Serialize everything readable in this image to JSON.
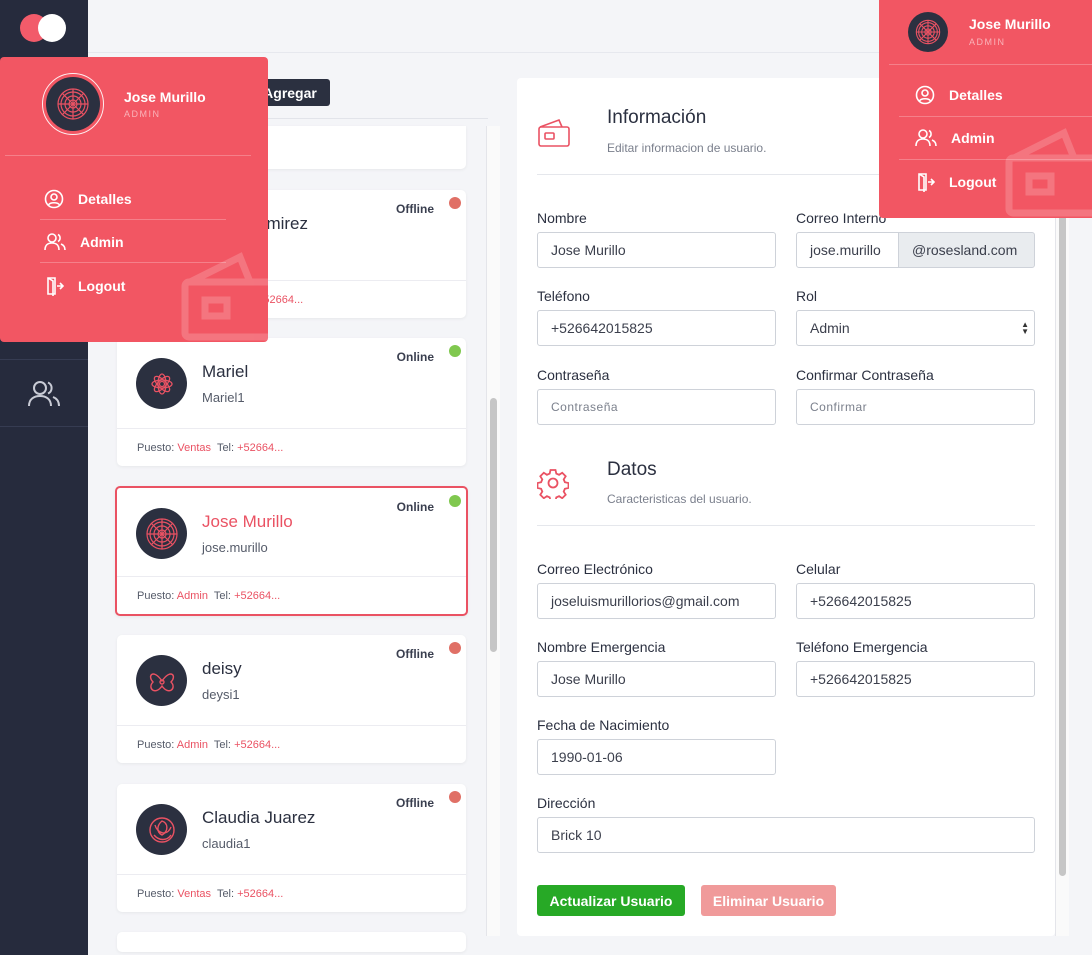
{
  "sidebar": {
    "logo": "brand-logo",
    "icons": [
      "users-icon"
    ]
  },
  "toolbar": {
    "add_label": "Agregar"
  },
  "users": [
    {
      "name": "amirez",
      "username": "",
      "status": "Offline",
      "online": false,
      "role": "",
      "phone": "+52664..."
    },
    {
      "name": "Mariel",
      "username": "Mariel1",
      "status": "Online",
      "online": true,
      "role": "Ventas",
      "phone": "+52664..."
    },
    {
      "name": "Jose Murillo",
      "username": "jose.murillo",
      "status": "Online",
      "online": true,
      "role": "Admin",
      "phone": "+52664..."
    },
    {
      "name": "deisy",
      "username": "deysi1",
      "status": "Offline",
      "online": false,
      "role": "Admin",
      "phone": "+52664..."
    },
    {
      "name": "Claudia Juarez",
      "username": "claudia1",
      "status": "Offline",
      "online": false,
      "role": "Ventas",
      "phone": "+52664..."
    }
  ],
  "card_labels": {
    "puesto": "Puesto:",
    "tel": "Tel:"
  },
  "form": {
    "info": {
      "title": "Información",
      "subtitle": "Editar informacion de usuario."
    },
    "nombre": {
      "label": "Nombre",
      "value": "Jose Murillo"
    },
    "correo_interno": {
      "label": "Correo Interno",
      "value": "jose.murillo",
      "domain": "@rosesland.com"
    },
    "telefono": {
      "label": "Teléfono",
      "value": "+526642015825"
    },
    "rol": {
      "label": "Rol",
      "value": "Admin"
    },
    "contrasena": {
      "label": "Contraseña",
      "placeholder": "Contraseña"
    },
    "confirmar": {
      "label": "Confirmar Contraseña",
      "placeholder": "Confirmar"
    },
    "datos": {
      "title": "Datos",
      "subtitle": "Caracteristicas del usuario."
    },
    "correo": {
      "label": "Correo Electrónico",
      "value": "joseluismurillorios@gmail.com"
    },
    "celular": {
      "label": "Celular",
      "value": "+526642015825"
    },
    "nombre_emergencia": {
      "label": "Nombre Emergencia",
      "value": "Jose Murillo"
    },
    "telefono_emergencia": {
      "label": "Teléfono Emergencia",
      "value": "+526642015825"
    },
    "fecha": {
      "label": "Fecha de Nacimiento",
      "value": "1990-01-06"
    },
    "direccion": {
      "label": "Dirección",
      "value": "Brick 10"
    },
    "update_label": "Actualizar Usuario",
    "delete_label": "Eliminar Usuario"
  },
  "menu": {
    "name": "Jose Murillo",
    "role": "ADMIN",
    "items": [
      "Detalles",
      "Admin",
      "Logout"
    ]
  },
  "colors": {
    "accent": "#f25663",
    "sidebar": "#262b3d",
    "online": "#80c84f",
    "offline": "#e07066",
    "success": "#27a926"
  }
}
